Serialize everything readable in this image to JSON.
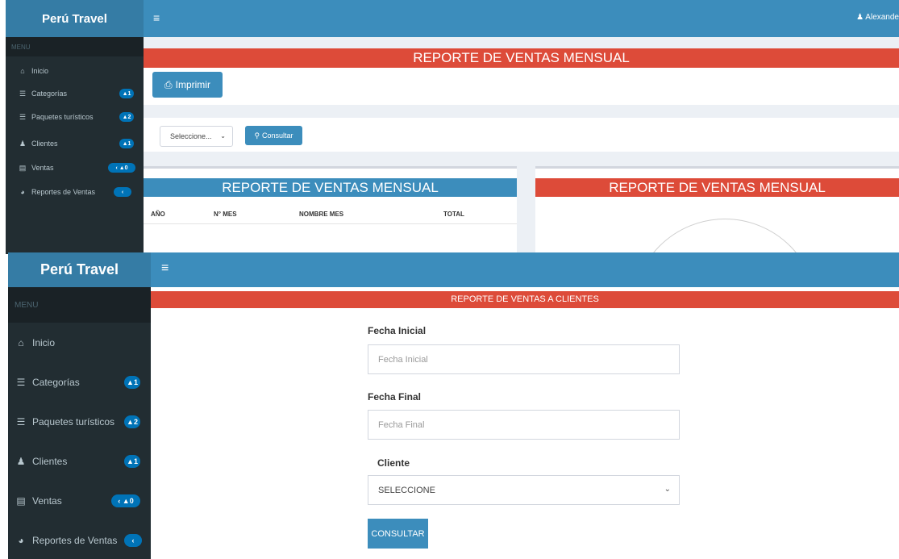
{
  "shot1": {
    "brand": "Perú Travel",
    "menu_icon": "bars-icon",
    "user_name": "Alexande",
    "menu_header": "MENU",
    "sidebar": [
      {
        "label": "Inicio",
        "icon": "home-icon",
        "badge": ""
      },
      {
        "label": "Categorías",
        "icon": "list-icon",
        "badge": "1"
      },
      {
        "label": "Paquetes turísticos",
        "icon": "list-icon",
        "badge": "2"
      },
      {
        "label": "Clientes",
        "icon": "users-icon",
        "badge": "1"
      },
      {
        "label": "Ventas",
        "icon": "briefcase-icon",
        "badge": "0"
      },
      {
        "label": "Reportes de Ventas",
        "icon": "pie-chart-icon",
        "badge": ""
      }
    ],
    "title": "REPORTE DE VENTAS MENSUAL",
    "print_label": "Imprimir",
    "select_value": "Seleccione...",
    "consult_label": "Consultar",
    "table_title": "REPORTE DE VENTAS MENSUAL",
    "table_headers": [
      "AÑO",
      "N° MES",
      "NOMBRE MES",
      "TOTAL"
    ],
    "chart_title": "REPORTE DE VENTAS MENSUAL"
  },
  "shot2": {
    "brand": "Perú Travel",
    "menu_header": "MENU",
    "sidebar": [
      {
        "label": "Inicio",
        "icon": "home-icon",
        "badge": ""
      },
      {
        "label": "Categorías",
        "icon": "list-icon",
        "badge": "1"
      },
      {
        "label": "Paquetes turísticos",
        "icon": "list-icon",
        "badge": "2"
      },
      {
        "label": "Clientes",
        "icon": "users-icon",
        "badge": "1"
      },
      {
        "label": "Ventas",
        "icon": "briefcase-icon",
        "badge": "0"
      },
      {
        "label": "Reportes de Ventas",
        "icon": "pie-chart-icon",
        "badge": ""
      }
    ],
    "title": "REPORTE DE VENTAS A CLIENTES",
    "fecha_inicial_label": "Fecha Inicial",
    "fecha_inicial_placeholder": "Fecha Inicial",
    "fecha_final_label": "Fecha Final",
    "fecha_final_placeholder": "Fecha Final",
    "cliente_label": "Cliente",
    "cliente_value": "SELECCIONE",
    "consult_label": "CONSULTAR"
  },
  "colors": {
    "sidebar_bg": "#222d32",
    "topbar_bg": "#3c8dbc",
    "brand_bg": "#357ca5",
    "title_red": "#dd4b39",
    "badge_blue": "#0073b7"
  }
}
